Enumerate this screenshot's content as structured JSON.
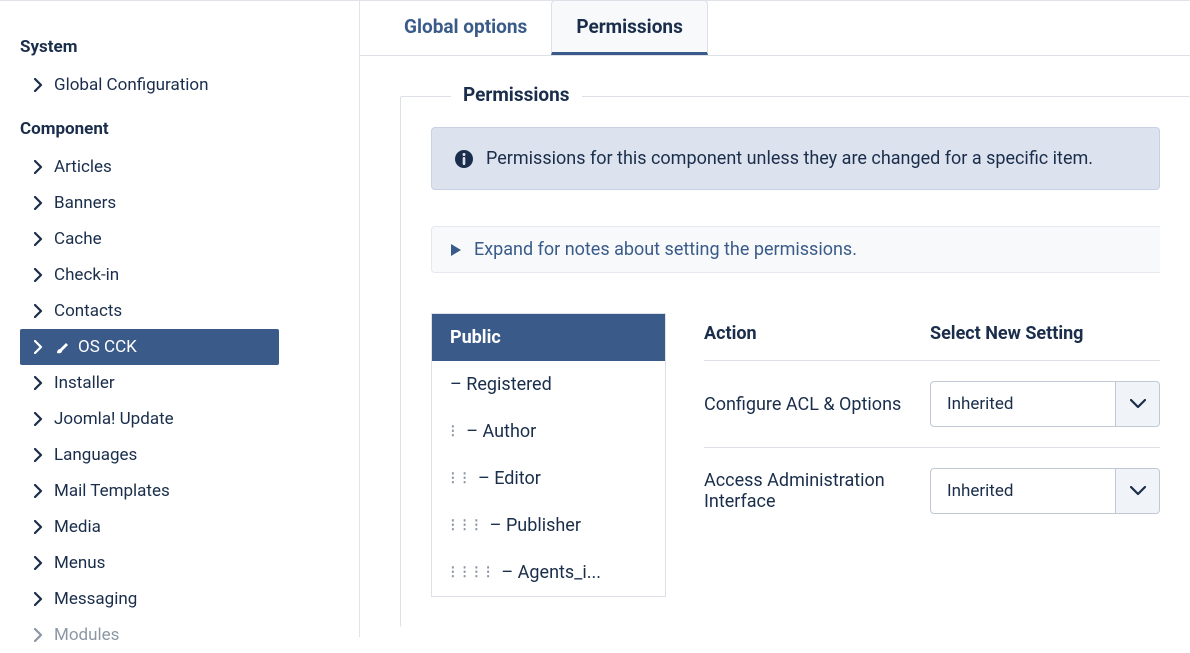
{
  "sidebar": {
    "system_heading": "System",
    "component_heading": "Component",
    "system_items": [
      {
        "label": "Global Configuration"
      }
    ],
    "component_items": [
      {
        "label": "Articles"
      },
      {
        "label": "Banners"
      },
      {
        "label": "Cache"
      },
      {
        "label": "Check-in"
      },
      {
        "label": "Contacts"
      },
      {
        "label": "OS CCK",
        "active": true,
        "icon": "brush"
      },
      {
        "label": "Installer"
      },
      {
        "label": "Joomla! Update"
      },
      {
        "label": "Languages"
      },
      {
        "label": "Mail Templates"
      },
      {
        "label": "Media"
      },
      {
        "label": "Menus"
      },
      {
        "label": "Messaging"
      },
      {
        "label": "Modules",
        "faded": true
      }
    ]
  },
  "tabs": {
    "global_options": "Global options",
    "permissions": "Permissions"
  },
  "panel": {
    "legend": "Permissions",
    "info_text": "Permissions for this component unless they are changed for a specific item.",
    "expand_text": "Expand for notes about setting the permissions."
  },
  "groups": [
    {
      "label": "Public",
      "indent": 0,
      "active": true
    },
    {
      "label": "– Registered",
      "indent": 0
    },
    {
      "label": "– Author",
      "indent": 1
    },
    {
      "label": "– Editor",
      "indent": 2
    },
    {
      "label": "– Publisher",
      "indent": 3
    },
    {
      "label": "– Agents_i...",
      "indent": 4
    }
  ],
  "actions_table": {
    "header_action": "Action",
    "header_setting": "Select New Setting",
    "rows": [
      {
        "action": "Configure ACL & Options",
        "setting": "Inherited"
      },
      {
        "action": "Access Administration Interface",
        "setting": "Inherited"
      }
    ]
  }
}
